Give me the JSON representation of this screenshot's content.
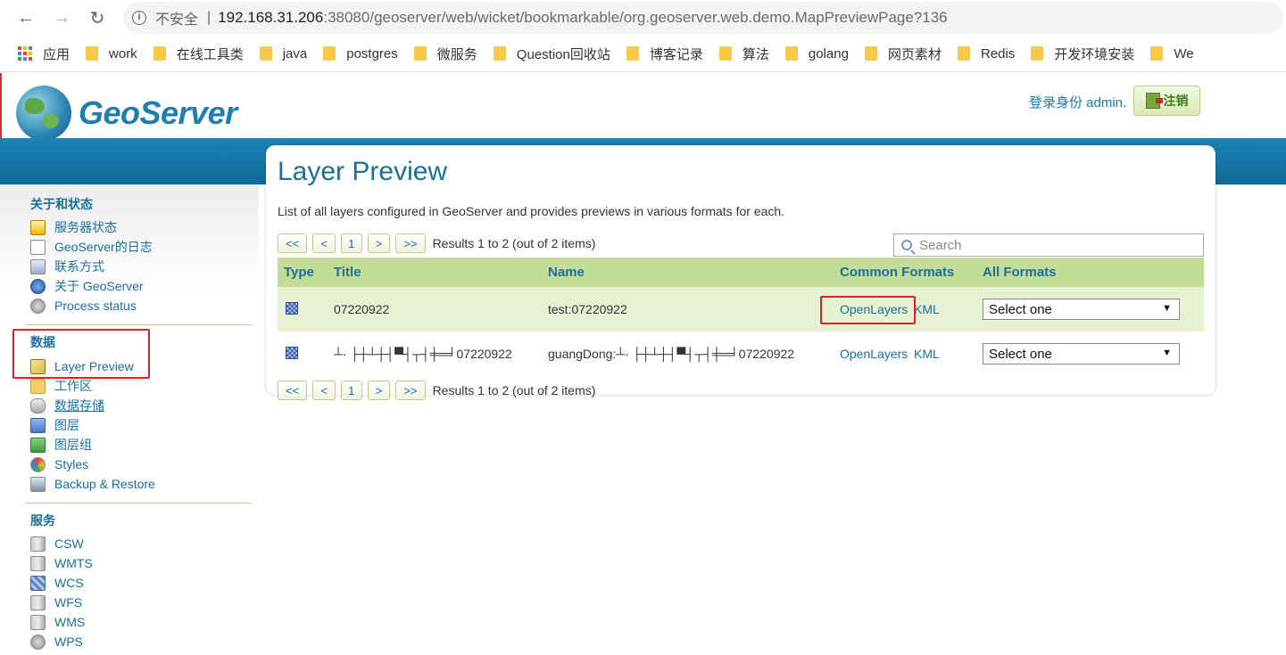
{
  "browser": {
    "security_label": "不安全",
    "url_host": "192.168.31.206",
    "url_rest": ":38080/geoserver/web/wicket/bookmarkable/org.geoserver.web.demo.MapPreviewPage?136",
    "bookmarks": [
      "应用",
      "work",
      "在线工具类",
      "java",
      "postgres",
      "微服务",
      "Question回收站",
      "博客记录",
      "算法",
      "golang",
      "网页素材",
      "Redis",
      "开发环境安装",
      "We"
    ]
  },
  "header": {
    "logo_text": "GeoServer",
    "login_info": "登录身份 admin.",
    "logout_label": "注销"
  },
  "sidebar": {
    "sections": [
      {
        "title": "关于和状态",
        "items": [
          "服务器状态",
          "GeoServer的日志",
          "联系方式",
          "关于 GeoServer",
          "Process status"
        ]
      },
      {
        "title": "数据",
        "items": [
          "Layer Preview",
          "工作区",
          "数据存储",
          "图层",
          "图层组",
          "Styles",
          "Backup & Restore"
        ]
      },
      {
        "title": "服务",
        "items": [
          "CSW",
          "WMTS",
          "WCS",
          "WFS",
          "WMS",
          "WPS"
        ]
      }
    ]
  },
  "main": {
    "title": "Layer Preview",
    "description": "List of all layers configured in GeoServer and provides previews in various formats for each.",
    "pager": {
      "first": "<<",
      "prev": "<",
      "page": "1",
      "next": ">",
      "last": ">>",
      "info": "Results 1 to 2 (out of 2 items)"
    },
    "search_placeholder": "Search",
    "columns": [
      "Type",
      "Title",
      "Name",
      "Common Formats",
      "All Formats"
    ],
    "rows": [
      {
        "title": "07220922",
        "name": "test:07220922",
        "formats": [
          "OpenLayers",
          "KML"
        ],
        "all_formats": "Select one"
      },
      {
        "title": "┴· ├┼┴┼┤▀┤┬┤╪═╛07220922",
        "name": "guangDong:┴· ├┼┴┼┤▀┤┬┤╪═╛07220922",
        "formats": [
          "OpenLayers",
          "KML"
        ],
        "all_formats": "Select one"
      }
    ]
  }
}
